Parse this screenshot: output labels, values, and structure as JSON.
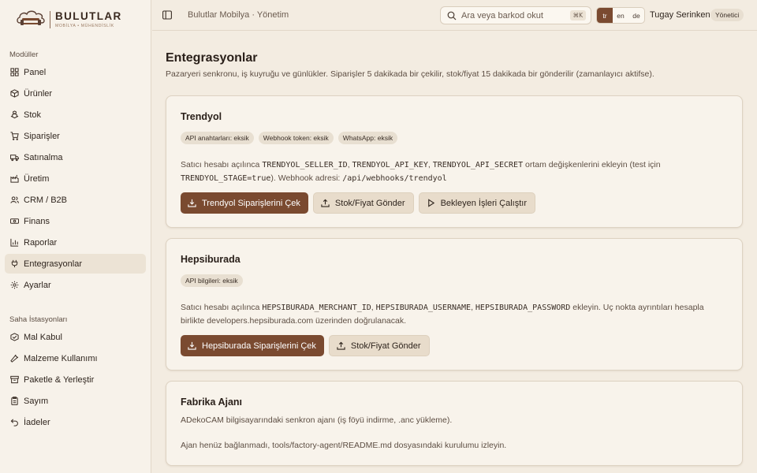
{
  "brand": {
    "name": "BULUTLAR",
    "tagline": "MOBİLYA • MÜHENDİSLİK"
  },
  "sidebar": {
    "section1": "Modüller",
    "items1": [
      {
        "label": "Panel",
        "icon": "dashboard-icon"
      },
      {
        "label": "Ürünler",
        "icon": "box-icon"
      },
      {
        "label": "Stok",
        "icon": "boxes-icon"
      },
      {
        "label": "Siparişler",
        "icon": "cart-icon"
      },
      {
        "label": "Satınalma",
        "icon": "truck-icon"
      },
      {
        "label": "Üretim",
        "icon": "factory-icon"
      },
      {
        "label": "CRM / B2B",
        "icon": "users-icon"
      },
      {
        "label": "Finans",
        "icon": "banknote-icon"
      },
      {
        "label": "Raporlar",
        "icon": "bar-chart-icon"
      },
      {
        "label": "Entegrasyonlar",
        "icon": "plug-icon"
      },
      {
        "label": "Ayarlar",
        "icon": "gear-icon"
      }
    ],
    "section2": "Saha İstasyonları",
    "items2": [
      {
        "label": "Mal Kabul",
        "icon": "package-check-icon"
      },
      {
        "label": "Malzeme Kullanımı",
        "icon": "wrench-icon"
      },
      {
        "label": "Paketle & Yerleştir",
        "icon": "archive-icon"
      },
      {
        "label": "Sayım",
        "icon": "clipboard-icon"
      },
      {
        "label": "İadeler",
        "icon": "undo-icon"
      }
    ]
  },
  "topbar": {
    "breadcrumb": "Bulutlar Mobilya · Yönetim",
    "search_placeholder": "Ara veya barkod okut",
    "search_shortcut": "⌘K",
    "languages": [
      "tr",
      "en",
      "de"
    ],
    "active_language": "tr",
    "user_name": "Tugay Serinken",
    "user_role": "Yönetici"
  },
  "page": {
    "title": "Entegrasyonlar",
    "description": "Pazaryeri senkronu, iş kuyruğu ve günlükler. Siparişler 5 dakikada bir çekilir, stok/fiyat 15 dakikada bir gönderilir (zamanlayıcı aktifse)."
  },
  "trendyol": {
    "title": "Trendyol",
    "chips": [
      "API anahtarları: eksik",
      "Webhook token: eksik",
      "WhatsApp: eksik"
    ],
    "text": {
      "t1": "Satıcı hesabı açılınca ",
      "c1": "TRENDYOL_SELLER_ID",
      "t2": ", ",
      "c2": "TRENDYOL_API_KEY",
      "t3": ", ",
      "c3": "TRENDYOL_API_SECRET",
      "t4": " ortam değişkenlerini ekleyin (test için",
      "c4": "TRENDYOL_STAGE=true",
      "t5": "). Webhook adresi: ",
      "c5": "/api/webhooks/trendyol"
    },
    "buttons": {
      "pull": "Trendyol Siparişlerini Çek",
      "push": "Stok/Fiyat Gönder",
      "run": "Bekleyen İşleri Çalıştır"
    }
  },
  "hepsiburada": {
    "title": "Hepsiburada",
    "chips": [
      "API bilgileri: eksik"
    ],
    "text": {
      "t1": "Satıcı hesabı açılınca ",
      "c1": "HEPSIBURADA_MERCHANT_ID",
      "t2": ", ",
      "c2": "HEPSIBURADA_USERNAME",
      "t3": ", ",
      "c3": "HEPSIBURADA_PASSWORD",
      "t4": " ekleyin. Uç nokta ayrıntıları hesapla",
      "t5": "birlikte developers.hepsiburada.com üzerinden doğrulanacak."
    },
    "buttons": {
      "pull": "Hepsiburada Siparişlerini Çek",
      "push": "Stok/Fiyat Gönder"
    }
  },
  "factory": {
    "title": "Fabrika Ajanı",
    "line1": "ADekoCAM bilgisayarındaki senkron ajanı (iş föyü indirme, .anc yükleme).",
    "line2": "Ajan henüz bağlanmadı, tools/factory-agent/README.md dosyasındaki kurulumu izleyin."
  }
}
